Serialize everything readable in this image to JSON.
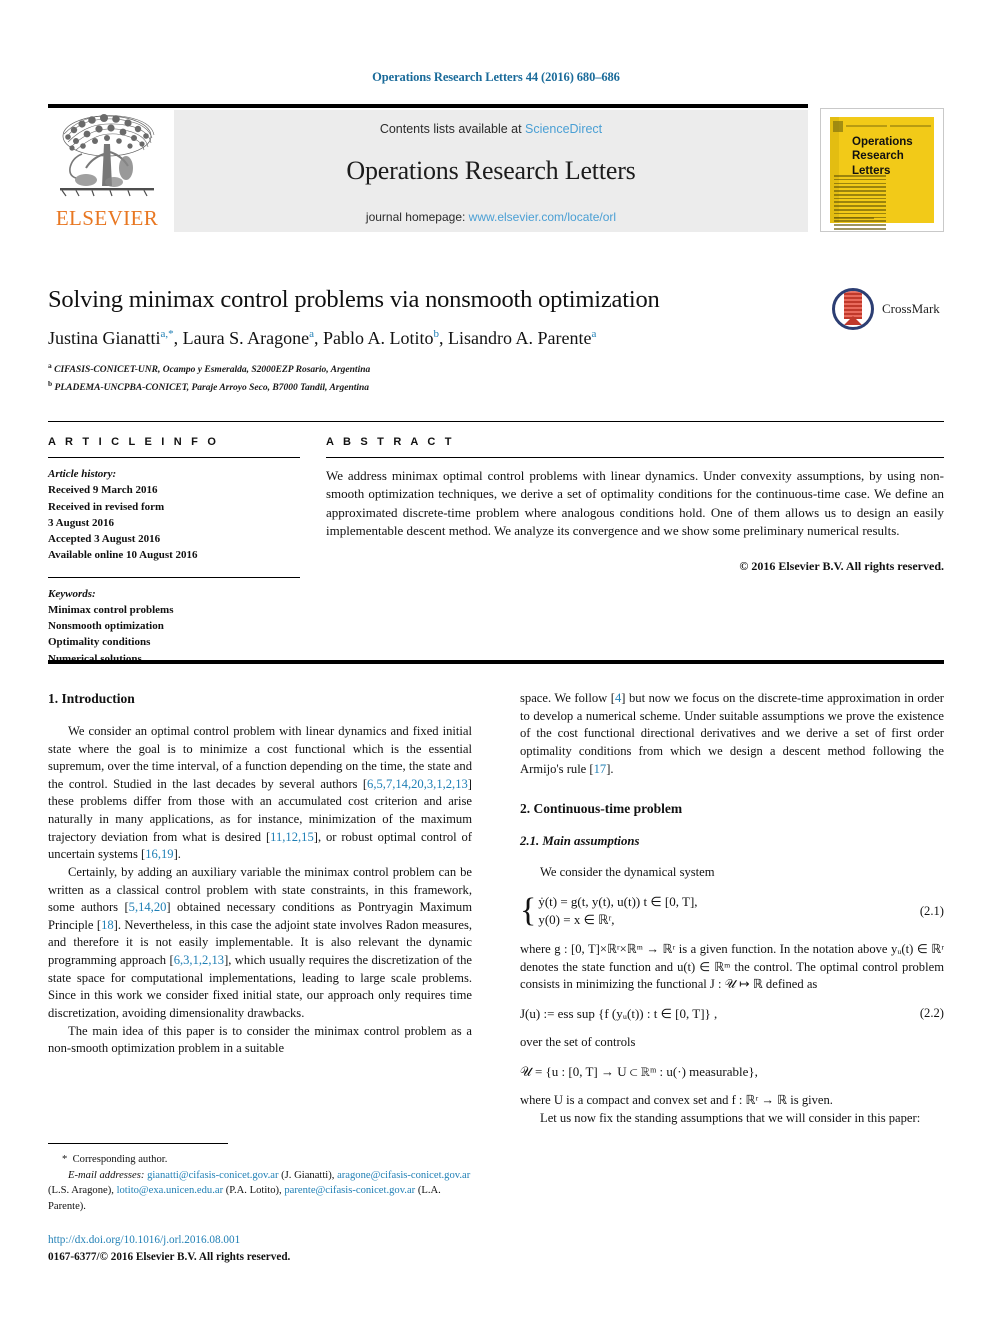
{
  "running_head": "Operations Research Letters 44 (2016) 680–686",
  "masthead": {
    "contents_prefix": "Contents lists available at ",
    "sciencedirect": "ScienceDirect",
    "journal_title": "Operations Research Letters",
    "homepage_prefix": "journal homepage: ",
    "homepage_url": "www.elsevier.com/locate/orl",
    "publisher": "ELSEVIER",
    "cover_title": "Operations\nResearch\nLetters"
  },
  "colors": {
    "link_blue": "#1f7fb5",
    "band_blue": "#4a9fd4",
    "elsevier_orange": "#E87722",
    "cover_yellow": "#F2CA18",
    "band_gray": "#ececec",
    "crossmark_navy": "#2c3e73",
    "crossmark_red": "#c0392b"
  },
  "article": {
    "title": "Solving minimax control problems via nonsmooth optimization",
    "authors_html": "Justina Gianatti<sup>a,*</sup>, Laura S. Aragone<sup>a</sup>, Pablo A. Lotito<sup>b</sup>, Lisandro A. Parente<sup>a</sup>",
    "affiliation_a": "CIFASIS-CONICET-UNR, Ocampo y Esmeralda, S2000EZP Rosario, Argentina",
    "affiliation_b": "PLADEMA-UNCPBA-CONICET, Paraje Arroyo Seco, B7000 Tandil, Argentina",
    "crossmark_label": "CrossMark"
  },
  "info": {
    "heading": "A R T I C L E   I N F O",
    "history_label": "Article history:",
    "history": [
      "Received 9 March 2016",
      "Received in revised form",
      "3 August 2016",
      "Accepted 3 August 2016",
      "Available online 10 August 2016"
    ],
    "keywords_label": "Keywords:",
    "keywords": [
      "Minimax control problems",
      "Nonsmooth optimization",
      "Optimality conditions",
      "Numerical solutions"
    ]
  },
  "abstract": {
    "heading": "A B S T R A C T",
    "text": "We address minimax optimal control problems with linear dynamics. Under convexity assumptions, by using non-smooth optimization techniques, we derive a set of optimality conditions for the continuous-time case. We define an approximated discrete-time problem where analogous conditions hold. One of them allows us to design an easily implementable descent method. We analyze its convergence and we show some preliminary numerical results.",
    "copyright": "© 2016 Elsevier B.V. All rights reserved."
  },
  "sections": {
    "intro_heading": "1. Introduction",
    "intro_p1_a": "We consider an optimal control problem with linear dynamics and fixed initial state where the goal is to minimize a cost functional which is the essential supremum, over the time interval, of a function depending on the time, the state and the control. Studied in the last decades by several authors [",
    "intro_p1_ref1": "6,5,7,14,20,3,1,2,13",
    "intro_p1_b": "] these problems differ from those with an accumulated cost criterion and arise naturally in many applications, as for instance, minimization of the maximum trajectory deviation from what is desired [",
    "intro_p1_ref2": "11,12,15",
    "intro_p1_c": "], or robust optimal control of uncertain systems [",
    "intro_p1_ref3": "16,19",
    "intro_p1_d": "].",
    "intro_p2_a": "Certainly, by adding an auxiliary variable the minimax control problem can be written as a classical control problem with state constraints, in this framework, some authors [",
    "intro_p2_ref1": "5,14,20",
    "intro_p2_b": "] obtained necessary conditions as Pontryagin Maximum Principle [",
    "intro_p2_ref2": "18",
    "intro_p2_c": "]. Nevertheless, in this case the adjoint state involves Radon measures, and therefore it is not easily implementable. It is also relevant the dynamic programming approach [",
    "intro_p2_ref3": "6,3,1,2,13",
    "intro_p2_d": "], which usually requires the discretization of the state space for computational implementations, leading to large scale problems. Since in this work we consider fixed initial state, our approach only requires time discretization, avoiding dimensionality drawbacks.",
    "intro_p3": "The main idea of this paper is to consider the minimax control problem as a non-smooth optimization problem in a suitable",
    "right_p1_a": "space. We follow [",
    "right_p1_ref1": "4",
    "right_p1_b": "] but now we focus on the discrete-time approximation in order to develop a numerical scheme. Under suitable assumptions we prove the existence of the cost functional directional derivatives and we derive a set of first order optimality conditions from which we design a descent method following the Armijo's rule [",
    "right_p1_ref2": "17",
    "right_p1_c": "].",
    "sec2_heading": "2. Continuous-time problem",
    "sec21_heading": "2.1. Main assumptions",
    "sec21_lead": "We consider the dynamical system",
    "eq21_line1": "ẏ(t) = g(t, y(t), u(t))    t ∈ [0, T],",
    "eq21_line2": "y(0) = x ∈ ℝʳ,",
    "eq21_number": "(2.1)",
    "after_eq21": "where g : [0, T]×ℝʳ×ℝᵐ → ℝʳ is a given function. In the notation above yᵤ(t) ∈ ℝʳ denotes the state function and u(t) ∈ ℝᵐ the control. The optimal control problem consists in minimizing the functional J : 𝒰 ↦ ℝ defined as",
    "eq22": "J(u) := ess sup {f (yᵤ(t)) : t ∈ [0, T]} ,",
    "eq22_number": "(2.2)",
    "after_eq22": "over the set of controls",
    "eq_controls": "𝒰 = {u : [0, T] → U ⊂ ℝᵐ : u(·) measurable},",
    "after_controls": "where U is a compact and convex set and f : ℝʳ → ℝ is given.",
    "last_para": "Let us now fix the standing assumptions that we will consider in this paper:"
  },
  "footnote": {
    "star": "*",
    "corresponding": "Corresponding author.",
    "email_label": "E-mail addresses:",
    "emails": [
      {
        "address": "gianatti@cifasis-conicet.gov.ar",
        "name": "(J. Gianatti),"
      },
      {
        "address": "aragone@cifasis-conicet.gov.ar",
        "name": "(L.S. Aragone),"
      },
      {
        "address": "lotito@exa.unicen.edu.ar",
        "name": "(P.A. Lotito),"
      },
      {
        "address": "parente@cifasis-conicet.gov.ar",
        "name": "(L.A. Parente)."
      }
    ],
    "doi": "http://dx.doi.org/10.1016/j.orl.2016.08.001",
    "issn_line": "0167-6377/© 2016 Elsevier B.V. All rights reserved."
  }
}
